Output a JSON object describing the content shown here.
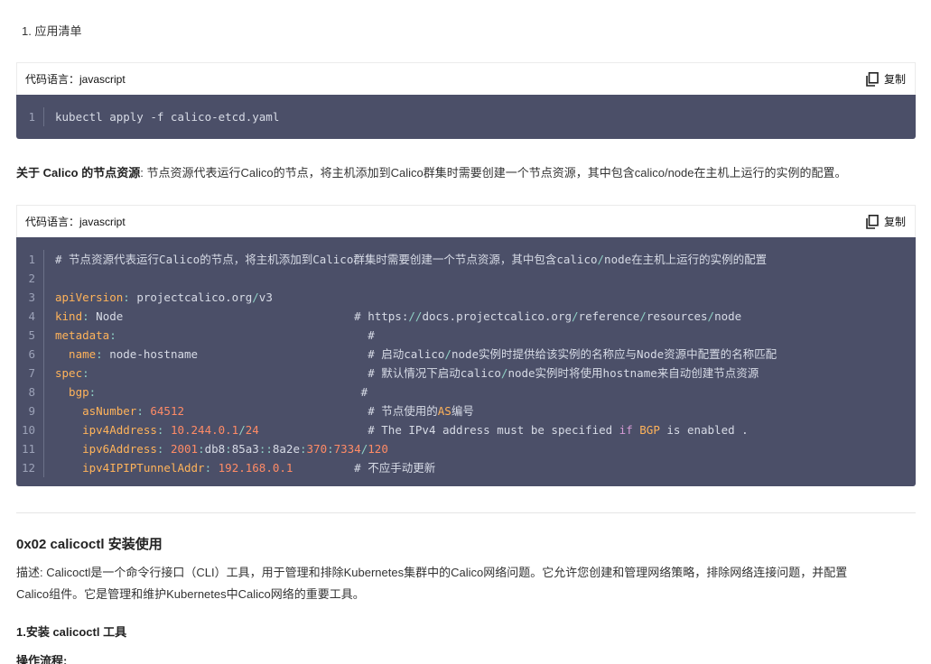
{
  "list_item": "1. 应用清单",
  "code1": {
    "lang_label": "代码语言：javascript",
    "copy_label": "复制",
    "lines": [
      {
        "n": "1",
        "tokens": [
          {
            "t": "kubectl apply -f calico-etcd.yaml",
            "c": "plain"
          }
        ]
      }
    ]
  },
  "about": {
    "strong": "关于 Calico 的节点资源",
    "text": ": 节点资源代表运行Calico的节点，将主机添加到Calico群集时需要创建一个节点资源，其中包含calico/node在主机上运行的实例的配置。"
  },
  "code2": {
    "lang_label": "代码语言：javascript",
    "copy_label": "复制",
    "lines": [
      {
        "n": "1",
        "tokens": [
          {
            "t": "# 节点资源代表运行Calico的节点，将主机添加到Calico群集时需要创建一个节点资源，其中包含calico",
            "c": "cmt"
          },
          {
            "t": "/",
            "c": "punc"
          },
          {
            "t": "node在主机上运行的实例的配置",
            "c": "cmt"
          }
        ]
      },
      {
        "n": "2",
        "tokens": [
          {
            "t": "",
            "c": "plain"
          }
        ]
      },
      {
        "n": "3",
        "tokens": [
          {
            "t": "apiVersion",
            "c": "key"
          },
          {
            "t": ": ",
            "c": "punc"
          },
          {
            "t": "projectcalico.org",
            "c": "plain"
          },
          {
            "t": "/",
            "c": "punc"
          },
          {
            "t": "v3",
            "c": "plain"
          }
        ]
      },
      {
        "n": "4",
        "tokens": [
          {
            "t": "kind",
            "c": "key"
          },
          {
            "t": ": ",
            "c": "punc"
          },
          {
            "t": "Node                                  ",
            "c": "plain"
          },
          {
            "t": "# https:",
            "c": "cmt"
          },
          {
            "t": "//",
            "c": "punc"
          },
          {
            "t": "docs.projectcalico.org",
            "c": "cmt"
          },
          {
            "t": "/",
            "c": "punc"
          },
          {
            "t": "reference",
            "c": "cmt"
          },
          {
            "t": "/",
            "c": "punc"
          },
          {
            "t": "resources",
            "c": "cmt"
          },
          {
            "t": "/",
            "c": "punc"
          },
          {
            "t": "node",
            "c": "cmt"
          }
        ]
      },
      {
        "n": "5",
        "tokens": [
          {
            "t": "metadata",
            "c": "key"
          },
          {
            "t": ":                                     ",
            "c": "punc"
          },
          {
            "t": "#",
            "c": "cmt"
          }
        ]
      },
      {
        "n": "6",
        "tokens": [
          {
            "t": "  name",
            "c": "key"
          },
          {
            "t": ": ",
            "c": "punc"
          },
          {
            "t": "node-hostname                         ",
            "c": "plain"
          },
          {
            "t": "# 启动calico",
            "c": "cmt"
          },
          {
            "t": "/",
            "c": "punc"
          },
          {
            "t": "node实例时提供给该实例的名称应与Node资源中配置的名称匹配",
            "c": "cmt"
          }
        ]
      },
      {
        "n": "7",
        "tokens": [
          {
            "t": "spec",
            "c": "key"
          },
          {
            "t": ":                                         ",
            "c": "punc"
          },
          {
            "t": "# 默认情况下启动calico",
            "c": "cmt"
          },
          {
            "t": "/",
            "c": "punc"
          },
          {
            "t": "node实例时将使用hostname来自动创建节点资源",
            "c": "cmt"
          }
        ]
      },
      {
        "n": "8",
        "tokens": [
          {
            "t": "  bgp",
            "c": "key"
          },
          {
            "t": ":                                       ",
            "c": "punc"
          },
          {
            "t": "#",
            "c": "cmt"
          }
        ]
      },
      {
        "n": "9",
        "tokens": [
          {
            "t": "    asNumber",
            "c": "key"
          },
          {
            "t": ": ",
            "c": "punc"
          },
          {
            "t": "64512",
            "c": "num"
          },
          {
            "t": "                           ",
            "c": "plain"
          },
          {
            "t": "# 节点使用的",
            "c": "cmt"
          },
          {
            "t": "AS",
            "c": "key"
          },
          {
            "t": "编号",
            "c": "cmt"
          }
        ]
      },
      {
        "n": "10",
        "tokens": [
          {
            "t": "    ipv4Address",
            "c": "key"
          },
          {
            "t": ": ",
            "c": "punc"
          },
          {
            "t": "10.244.0.1",
            "c": "num"
          },
          {
            "t": "/",
            "c": "punc"
          },
          {
            "t": "24",
            "c": "num"
          },
          {
            "t": "                # The IPv4 address must be specified ",
            "c": "cmt"
          },
          {
            "t": "if",
            "c": "kw"
          },
          {
            "t": " ",
            "c": "cmt"
          },
          {
            "t": "BGP",
            "c": "key"
          },
          {
            "t": " is enabled .",
            "c": "cmt"
          }
        ]
      },
      {
        "n": "11",
        "tokens": [
          {
            "t": "    ipv6Address",
            "c": "key"
          },
          {
            "t": ": ",
            "c": "punc"
          },
          {
            "t": "2001",
            "c": "num"
          },
          {
            "t": ":",
            "c": "punc"
          },
          {
            "t": "db8",
            "c": "plain"
          },
          {
            "t": ":",
            "c": "punc"
          },
          {
            "t": "85a3",
            "c": "plain"
          },
          {
            "t": "::",
            "c": "punc"
          },
          {
            "t": "8a2e",
            "c": "plain"
          },
          {
            "t": ":",
            "c": "punc"
          },
          {
            "t": "370",
            "c": "num"
          },
          {
            "t": ":",
            "c": "punc"
          },
          {
            "t": "7334",
            "c": "num"
          },
          {
            "t": "/",
            "c": "punc"
          },
          {
            "t": "120",
            "c": "num"
          }
        ]
      },
      {
        "n": "12",
        "tokens": [
          {
            "t": "    ipv4IPIPTunnelAddr",
            "c": "key"
          },
          {
            "t": ": ",
            "c": "punc"
          },
          {
            "t": "192.168.0.1",
            "c": "num"
          },
          {
            "t": "         ",
            "c": "plain"
          },
          {
            "t": "# 不应手动更新",
            "c": "cmt"
          }
        ]
      }
    ]
  },
  "section_title": "0x02 calicoctl 安装使用",
  "desc_line1": "描述: Calicoctl是一个命令行接口（CLI）工具，用于管理和排除Kubernetes集群中的Calico网络问题。它允许您创建和管理网络策略，排除网络连接问题，并配置",
  "desc_line2": "Calico组件。它是管理和维护Kubernetes中Calico网络的重要工具。",
  "sub_title": "1.安装 calicoctl 工具",
  "ops_label": "操作流程:",
  "colors": {
    "code_bg": "#4b4f68",
    "key": "#ffb35a",
    "number": "#ff8b66",
    "punct": "#8fd1c5",
    "keyword": "#d69bd6"
  },
  "icons": {
    "copy": "copy-icon"
  }
}
